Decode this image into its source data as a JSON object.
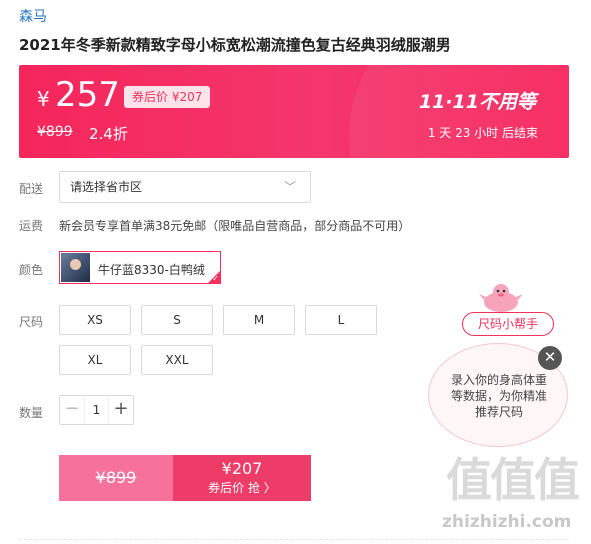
{
  "product": {
    "brand": "森马",
    "title": "2021年冬季新款精致字母小标宽松潮流撞色复古经典羽绒服潮男"
  },
  "price_banner": {
    "currency": "¥",
    "price": "257",
    "coupon_price": "券后价 ¥207",
    "original_price": "¥899",
    "discount": "2.4折",
    "promo_title": "11·11不用等",
    "promo_time": "1 天 23 小时 后结束"
  },
  "delivery": {
    "label": "配送",
    "select_value": "请选择省市区",
    "chevron_icon": "chevron-down-icon"
  },
  "shipping": {
    "label": "运费",
    "text": "新会员专享首单满38元免邮（限唯品自营商品，部分商品不可用）"
  },
  "color": {
    "label": "颜色",
    "selected": "牛仔蓝8330-白鸭绒"
  },
  "size": {
    "label": "尺码",
    "options": [
      "XS",
      "S",
      "M",
      "L",
      "XL",
      "XXL"
    ]
  },
  "quantity": {
    "label": "数量",
    "value": "1",
    "minus": "−",
    "plus": "+"
  },
  "buy": {
    "original": "¥899",
    "coupon_price": "¥207",
    "coupon_action": "券后价 抢 〉"
  },
  "size_helper": {
    "tag": "尺码小帮手",
    "bubble_text": "录入你的身高体重等数据，为你精准推荐尺码",
    "close": "✕"
  },
  "watermark": {
    "mark": "值值值",
    "site": "zhizhizhi.com"
  },
  "colors": {
    "accent": "#f1325c",
    "banner": "#f5265b",
    "brand_link": "#2a76c6",
    "buy_light": "#f7729a",
    "buy_dark": "#ee3c68"
  }
}
